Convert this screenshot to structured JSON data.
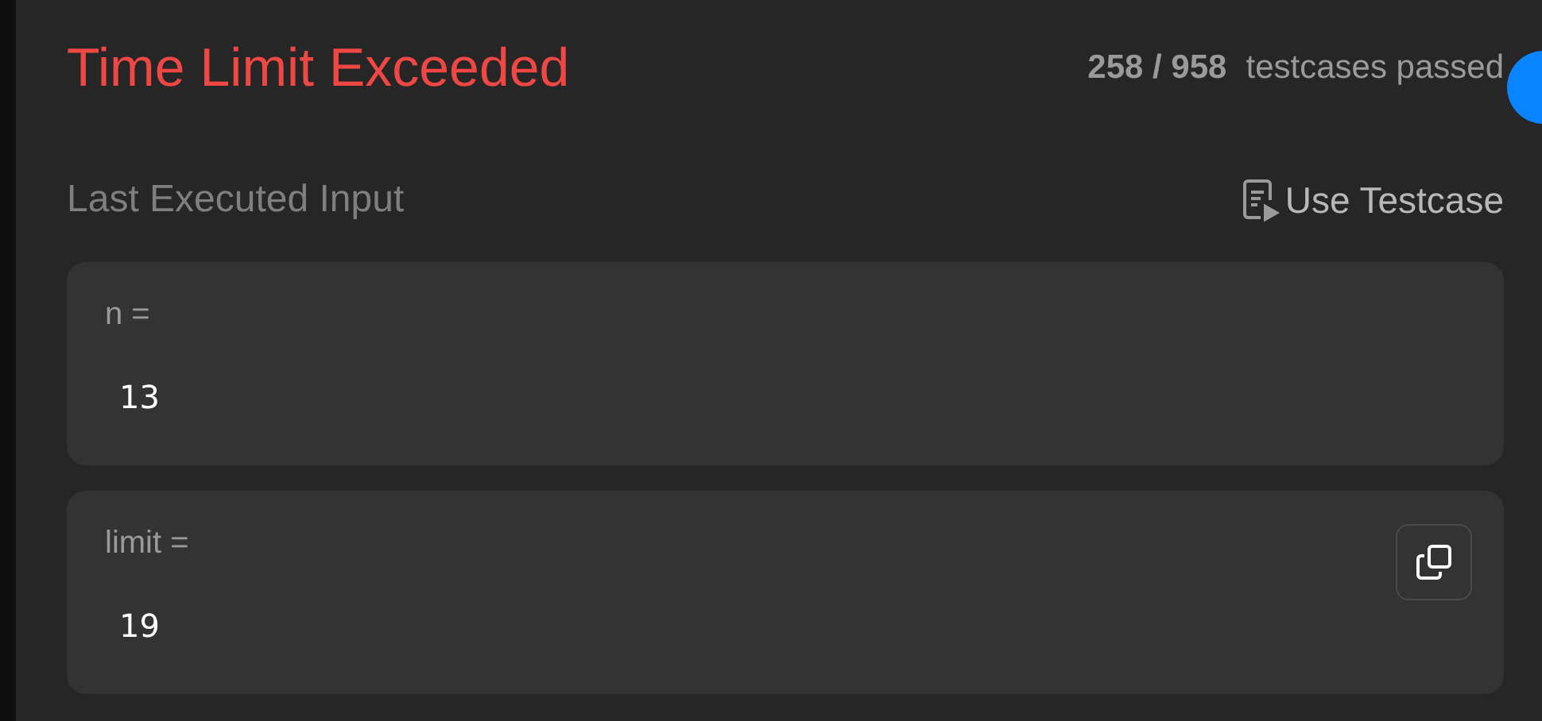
{
  "result": {
    "title": "Time Limit Exceeded",
    "kind": "error",
    "passed": "258 / 958",
    "passed_label": "testcases passed"
  },
  "section": {
    "title": "Last Executed Input",
    "action": "Use Testcase"
  },
  "inputs": [
    {
      "label": "n =",
      "value": "13",
      "copy_button": false
    },
    {
      "label": "limit =",
      "value": "19",
      "copy_button": true
    }
  ]
}
